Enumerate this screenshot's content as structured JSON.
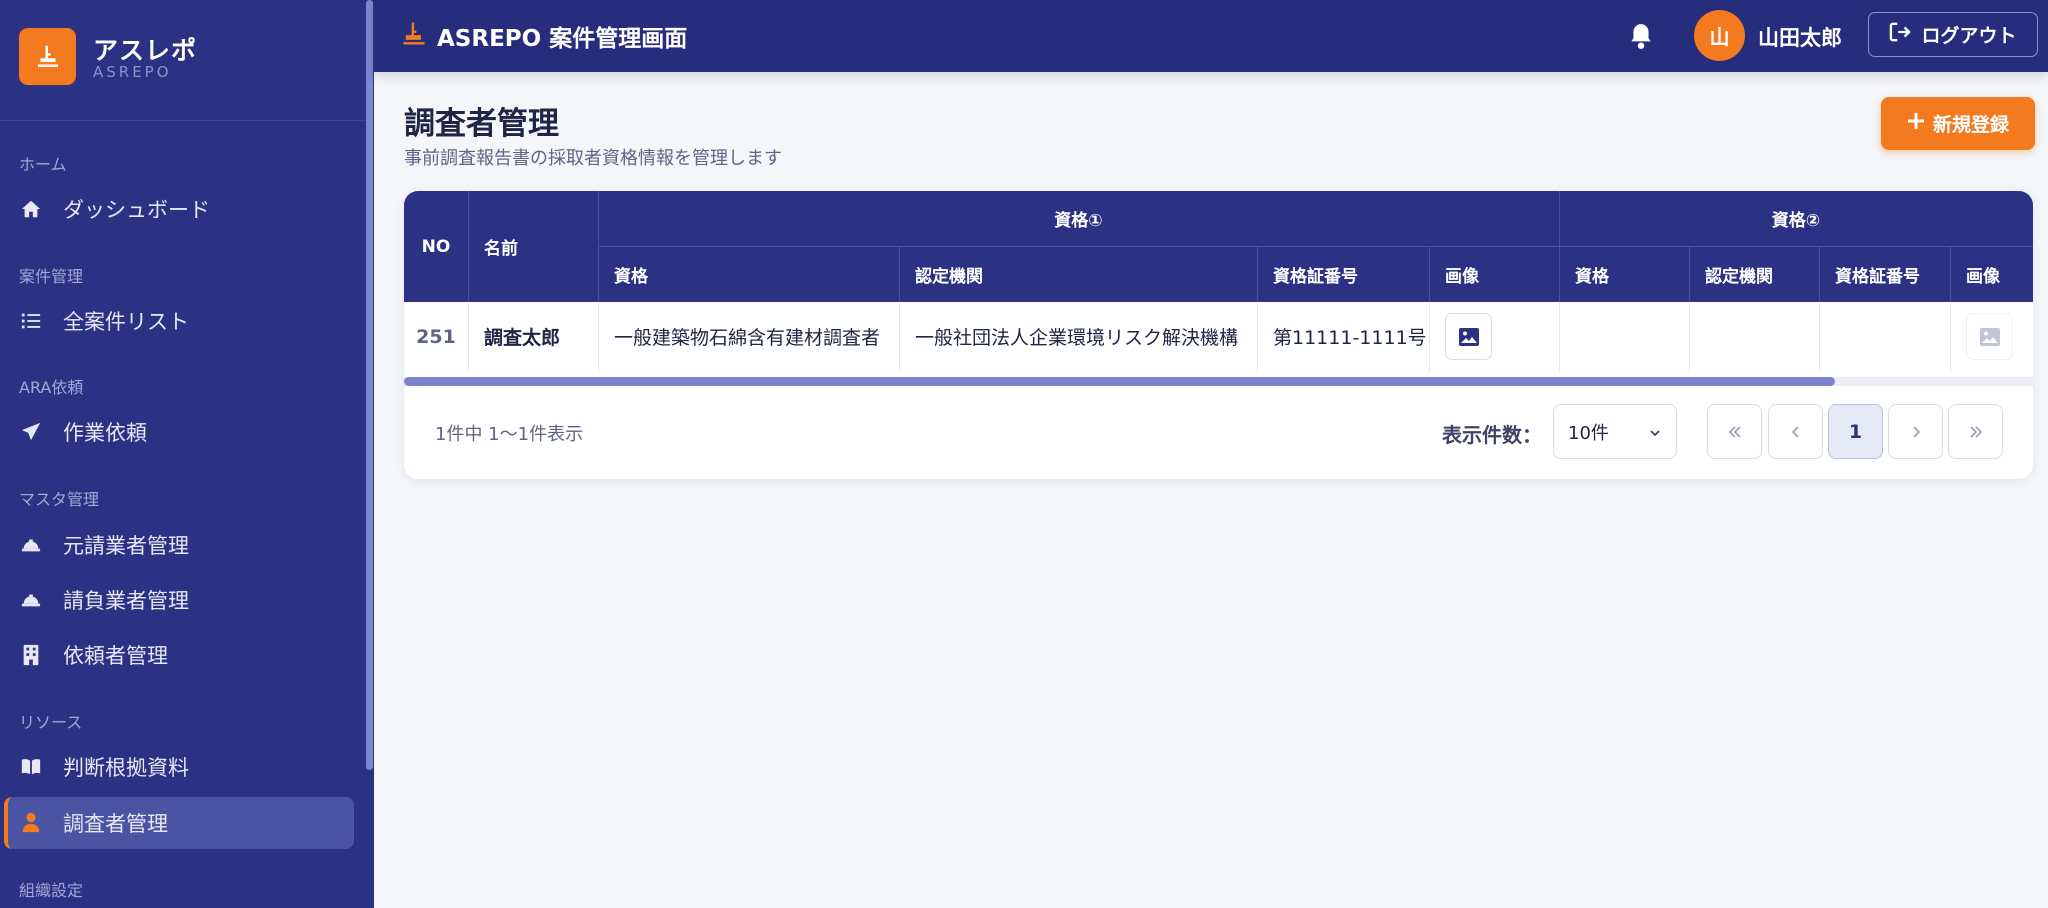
{
  "brand": {
    "name": "アスレポ",
    "sub": "ASREPO"
  },
  "sidebar": {
    "sections": [
      {
        "label": "ホーム",
        "items": [
          {
            "label": "ダッシュボード",
            "icon": "home-icon"
          }
        ]
      },
      {
        "label": "案件管理",
        "items": [
          {
            "label": "全案件リスト",
            "icon": "list-icon"
          }
        ]
      },
      {
        "label": "ARA依頼",
        "items": [
          {
            "label": "作業依頼",
            "icon": "paper-plane-icon"
          }
        ]
      },
      {
        "label": "マスタ管理",
        "items": [
          {
            "label": "元請業者管理",
            "icon": "hard-hat-icon"
          },
          {
            "label": "請負業者管理",
            "icon": "hard-hat-icon"
          },
          {
            "label": "依頼者管理",
            "icon": "building-icon"
          }
        ]
      },
      {
        "label": "リソース",
        "items": [
          {
            "label": "判断根拠資料",
            "icon": "book-icon"
          },
          {
            "label": "調査者管理",
            "icon": "user-icon",
            "active": true
          }
        ]
      },
      {
        "label": "組織設定",
        "items": []
      }
    ]
  },
  "topbar": {
    "title": "ASREPO 案件管理画面",
    "user_initial": "山",
    "user_name": "山田太郎",
    "logout_label": "ログアウト"
  },
  "page": {
    "title": "調査者管理",
    "subtitle": "事前調査報告書の採取者資格情報を管理します",
    "new_button": "新規登録"
  },
  "table": {
    "headers": {
      "no": "NO",
      "name": "名前",
      "group1": "資格①",
      "group2": "資格②",
      "qualification": "資格",
      "authority": "認定機関",
      "cert_no": "資格証番号",
      "image": "画像"
    },
    "rows": [
      {
        "no": "251",
        "name": "調査太郎",
        "q1": "一般建築物石綿含有建材調査者",
        "a1": "一般社団法人企業環境リスク解決機構",
        "c1": "第11111-1111号",
        "q2": "",
        "a2": "",
        "c2": ""
      }
    ]
  },
  "footer": {
    "summary": "1件中 1〜1件表示",
    "per_page_label": "表示件数：",
    "per_page_value": "10件",
    "current_page": "1"
  },
  "colors": {
    "sidebar": "#2b3183",
    "topbar": "#262d7d",
    "accent": "#f47a1f",
    "active_item": "#4b54a2"
  }
}
